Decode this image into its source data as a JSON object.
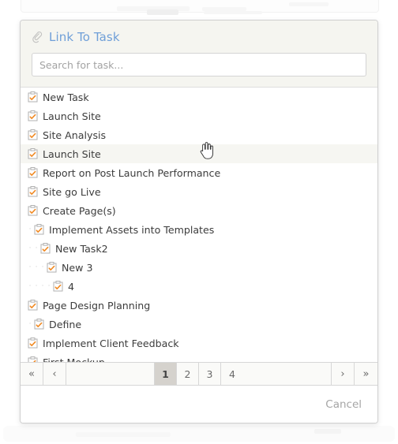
{
  "dialog": {
    "title": "Link To Task",
    "title_icon": "paperclip-icon",
    "accent_color": "#6f9fd8"
  },
  "search": {
    "value": "",
    "placeholder": "Search for task..."
  },
  "tasks": [
    {
      "label": "New Task",
      "depth": 0,
      "icon": "task-clipboard-icon",
      "hover": false
    },
    {
      "label": "Launch Site",
      "depth": 0,
      "icon": "task-clipboard-icon",
      "hover": false
    },
    {
      "label": "Site Analysis",
      "depth": 0,
      "icon": "task-clipboard-icon",
      "hover": false
    },
    {
      "label": "Launch Site",
      "depth": 0,
      "icon": "task-clipboard-icon",
      "hover": true
    },
    {
      "label": "Report on Post Launch Performance",
      "depth": 0,
      "icon": "task-clipboard-icon",
      "hover": false
    },
    {
      "label": "Site go Live",
      "depth": 0,
      "icon": "task-clipboard-icon",
      "hover": false
    },
    {
      "label": "Create Page(s)",
      "depth": 0,
      "icon": "task-clipboard-icon",
      "hover": false
    },
    {
      "label": "Implement Assets into Templates",
      "depth": 1,
      "icon": "task-clipboard-icon",
      "hover": false
    },
    {
      "label": "New Task2",
      "depth": 2,
      "icon": "task-clipboard-icon",
      "hover": false
    },
    {
      "label": "New 3",
      "depth": 3,
      "icon": "task-clipboard-icon",
      "hover": false
    },
    {
      "label": "4",
      "depth": 4,
      "icon": "task-clipboard-icon",
      "hover": false
    },
    {
      "label": "Page Design Planning",
      "depth": 0,
      "icon": "task-clipboard-icon",
      "hover": false
    },
    {
      "label": "Define",
      "depth": 1,
      "icon": "task-clipboard-icon",
      "hover": false
    },
    {
      "label": "Implement Client Feedback",
      "depth": 0,
      "icon": "task-clipboard-icon",
      "hover": false
    },
    {
      "label": "First Mockup",
      "depth": 0,
      "icon": "task-clipboard-icon",
      "hover": false
    }
  ],
  "pagination": {
    "first_label": "«",
    "prev_label": "‹",
    "next_label": "›",
    "last_label": "»",
    "pages": [
      "1",
      "2",
      "3",
      "4"
    ],
    "active_page": "1"
  },
  "footer": {
    "cancel_label": "Cancel"
  },
  "cursor": {
    "icon": "pointing-hand-cursor"
  }
}
